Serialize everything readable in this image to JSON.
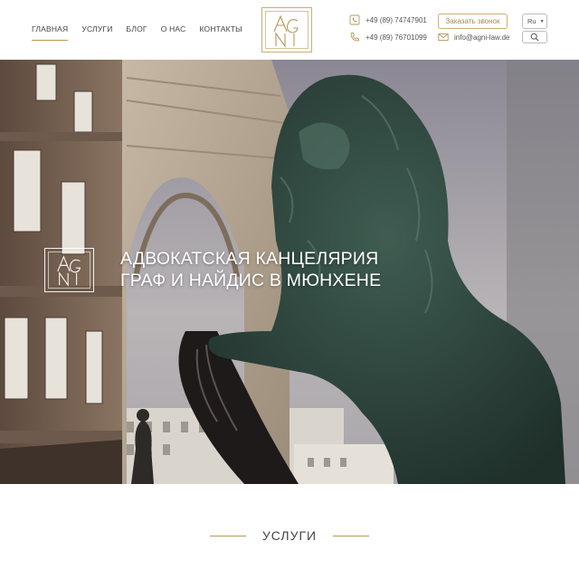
{
  "header": {
    "nav": [
      {
        "label": "ГЛАВНАЯ",
        "active": true
      },
      {
        "label": "УСЛУГИ",
        "active": false
      },
      {
        "label": "БЛОГ",
        "active": false
      },
      {
        "label": "О НАС",
        "active": false
      },
      {
        "label": "КОНТАКТЫ",
        "active": false
      }
    ],
    "logo_text": "AGNI",
    "phone1": "+49 (89) 74747901",
    "phone2": "+49 (89) 76701099",
    "email": "info@agni-law.de",
    "call_button": "Заказать звонок",
    "language": "Ru",
    "icons": {
      "phone1": "phone-icon",
      "phone2": "phone-icon",
      "email": "envelope-icon",
      "search": "search-icon",
      "lang_caret": "caret-down-icon"
    }
  },
  "hero": {
    "title_line1": "АДВОКАТСКАЯ КАНЦЕЛЯРИЯ",
    "title_line2": "ГРАФ И НАЙДИС В МЮНХЕНЕ"
  },
  "services": {
    "heading": "УСЛУГИ"
  },
  "colors": {
    "accent": "#b7975a",
    "statue": "#2f4a41"
  }
}
